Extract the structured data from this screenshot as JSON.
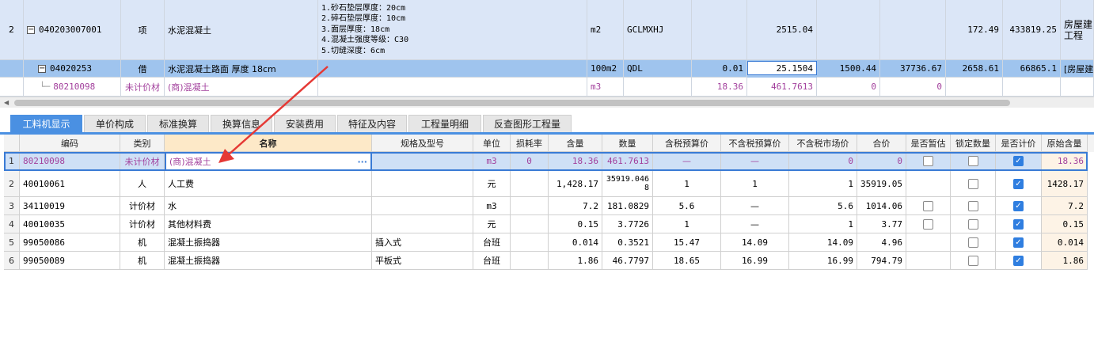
{
  "upper": {
    "main_row": {
      "num": "2",
      "expand": "−",
      "code": "040203007001",
      "type": "项",
      "name": "水泥混凝土",
      "features": [
        "1.砂石垫层厚度：20cm",
        "2.碎石垫层厚度：10cm",
        "3.面层厚度：18cm",
        "4.混凝土强度等级：C30",
        "5.切缝深度：6cm"
      ],
      "unit": "m2",
      "formula": "GCLMXHJ",
      "qty": "2515.04",
      "v1": "",
      "v2": "",
      "v3": "172.49",
      "v4": "433819.25",
      "spec_line1": "房屋建",
      "spec_line2": "工程"
    },
    "sel_row": {
      "expand": "−",
      "code": "04020253",
      "type": "借",
      "name": "水泥混凝土路面 厚度 18cm",
      "unit": "100m2",
      "formula": "QDL",
      "ratio": "0.01",
      "qty": "25.1504",
      "v1": "1500.44",
      "v2": "37736.67",
      "v3": "2658.61",
      "v4": "66865.1",
      "spec": "[房屋建"
    },
    "sub_row": {
      "code": "80210098",
      "type": "未计价材",
      "name": "(商)混凝土",
      "unit": "m3",
      "ratio": "18.36",
      "qty": "461.7613",
      "v1": "0",
      "v2": "0"
    }
  },
  "tabs": [
    "工料机显示",
    "单价构成",
    "标准换算",
    "换算信息",
    "安装费用",
    "特征及内容",
    "工程量明细",
    "反查图形工程量"
  ],
  "table": {
    "headers": [
      "编码",
      "类别",
      "名称",
      "规格及型号",
      "单位",
      "损耗率",
      "含量",
      "数量",
      "含税预算价",
      "不含税预算价",
      "不含税市场价",
      "合价",
      "是否暂估",
      "锁定数量",
      "是否计价",
      "原始含量"
    ],
    "rows": [
      {
        "num": "1",
        "code": "80210098",
        "cat": "未计价材",
        "name": "(商)混凝土",
        "name_ellipsis": "···",
        "spec": "",
        "unit": "m3",
        "loss": "0",
        "content": "18.36",
        "qty": "461.7613",
        "p1": "—",
        "p2": "—",
        "p3": "0",
        "total": "0",
        "est": false,
        "lock": false,
        "price": true,
        "orig": "18.36"
      },
      {
        "num": "2",
        "code": "40010061",
        "cat": "人",
        "name": "人工费",
        "spec": "",
        "unit": "元",
        "loss": "",
        "content": "1,428.17",
        "qty": "35919.0468",
        "p1": "1",
        "p2": "1",
        "p3": "1",
        "total": "35919.05",
        "est": null,
        "lock": false,
        "price": true,
        "orig": "1428.17"
      },
      {
        "num": "3",
        "code": "34110019",
        "cat": "计价材",
        "name": "水",
        "spec": "",
        "unit": "m3",
        "loss": "",
        "content": "7.2",
        "qty": "181.0829",
        "p1": "5.6",
        "p2": "—",
        "p3": "5.6",
        "total": "1014.06",
        "est": false,
        "lock": false,
        "price": true,
        "orig": "7.2"
      },
      {
        "num": "4",
        "code": "40010035",
        "cat": "计价材",
        "name": "其他材料费",
        "spec": "",
        "unit": "元",
        "loss": "",
        "content": "0.15",
        "qty": "3.7726",
        "p1": "1",
        "p2": "—",
        "p3": "1",
        "total": "3.77",
        "est": false,
        "lock": false,
        "price": true,
        "orig": "0.15"
      },
      {
        "num": "5",
        "code": "99050086",
        "cat": "机",
        "name": "混凝土振捣器",
        "spec": "插入式",
        "unit": "台班",
        "loss": "",
        "content": "0.014",
        "qty": "0.3521",
        "p1": "15.47",
        "p2": "14.09",
        "p3": "14.09",
        "total": "4.96",
        "est": null,
        "lock": false,
        "price": true,
        "orig": "0.014"
      },
      {
        "num": "6",
        "code": "99050089",
        "cat": "机",
        "name": "混凝土振捣器",
        "spec": "平板式",
        "unit": "台班",
        "loss": "",
        "content": "1.86",
        "qty": "46.7797",
        "p1": "18.65",
        "p2": "16.99",
        "p3": "16.99",
        "total": "794.79",
        "est": null,
        "lock": false,
        "price": true,
        "orig": "1.86"
      }
    ]
  },
  "colors": {
    "accent": "#4a90e2",
    "selected_row": "#9fc4ee",
    "material_text": "#a23f9c",
    "annotation_arrow": "#e53935"
  }
}
